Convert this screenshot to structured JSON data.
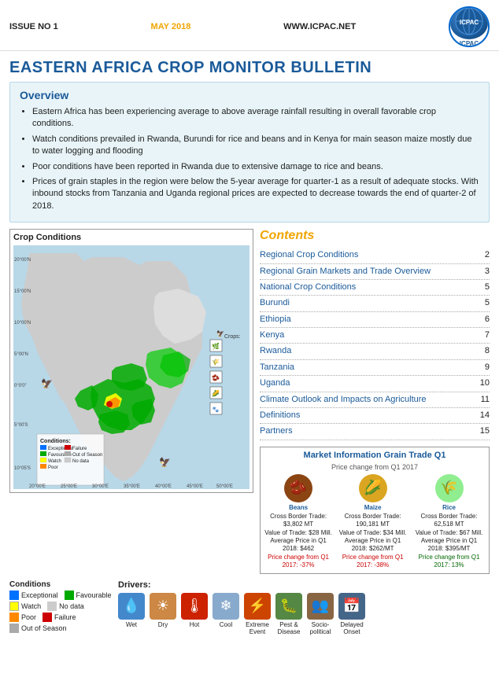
{
  "header": {
    "issue": "ISSUE NO 1",
    "date": "MAY 2018",
    "website": "WWW.ICPAC.NET",
    "logo_text": "ICPAC",
    "logo_sub": "ICPAC"
  },
  "main_title": "EASTERN AFRICA CROP MONITOR BULLETIN",
  "overview": {
    "title": "Overview",
    "bullets": [
      "Eastern Africa has been experiencing average to above average rainfall resulting in overall favorable crop conditions.",
      "Watch conditions prevailed in Rwanda, Burundi for rice and beans and in Kenya for main season maize mostly due to water logging and flooding",
      "Poor conditions have been reported in Rwanda due to extensive damage to rice and beans.",
      "Prices of grain staples in the region were below the 5-year average for quarter-1 as a result of adequate stocks. With inbound stocks from Tanzania and Uganda regional prices are expected to decrease towards the end of quarter-2 of 2018."
    ]
  },
  "crop_conditions": {
    "title": "Crop Conditions",
    "legend": {
      "title": "Conditions",
      "items": [
        {
          "label": "Exceptional",
          "color": "#0070ff"
        },
        {
          "label": "Favourable",
          "color": "#00aa00"
        },
        {
          "label": "Watch",
          "color": "#ffff00"
        },
        {
          "label": "No data",
          "color": "#cccccc"
        },
        {
          "label": "Poor",
          "color": "#ff8800"
        },
        {
          "label": "Failure",
          "color": "#cc0000"
        },
        {
          "label": "Out of Season",
          "color": "#aaaaaa"
        }
      ]
    },
    "map_x_labels": [
      "20°00'E",
      "25°00'E",
      "30°00'E",
      "35°00'E",
      "40°00'E",
      "45°00'E",
      "50°00'E"
    ],
    "map_y_labels": [
      "20°00'N",
      "15°00'N",
      "10°00'N",
      "5°00'N",
      "0°0'0\"",
      "5°00'S",
      "10°05'S"
    ]
  },
  "drivers": {
    "title": "Drivers:",
    "items": [
      {
        "label": "Wet",
        "icon": "💧",
        "color": "#4488cc"
      },
      {
        "label": "Dry",
        "icon": "☀",
        "color": "#cc8844"
      },
      {
        "label": "Hot",
        "icon": "🌡",
        "color": "#cc2200"
      },
      {
        "label": "Cool",
        "icon": "❄",
        "color": "#88aacc"
      }
    ],
    "extreme_items": [
      {
        "label": "Extreme\nEvent",
        "icon": "⚡",
        "color": "#cc4400"
      },
      {
        "label": "Pest &\nDisease",
        "icon": "🐛",
        "color": "#558844"
      },
      {
        "label": "Socio-\npolitical",
        "icon": "👥",
        "color": "#886644"
      },
      {
        "label": "Delayed\nOnset",
        "icon": "📅",
        "color": "#446688"
      }
    ]
  },
  "contents": {
    "title": "Contents",
    "items": [
      {
        "label": "Regional Crop Conditions",
        "dots": "......................",
        "page": "2"
      },
      {
        "label": "Regional Grain Markets and Trade Overview",
        "dots": "....................................................",
        "page": "3"
      },
      {
        "label": "National Crop Conditions",
        "dots": "....................",
        "page": "5"
      },
      {
        "label": "Burundi",
        "dots": "...................................................",
        "page": "5"
      },
      {
        "label": "Ethiopia",
        "dots": "..................................................",
        "page": "6"
      },
      {
        "label": "Kenya",
        "dots": ".....................................................",
        "page": "7"
      },
      {
        "label": "Rwanda",
        "dots": "...........................................",
        "page": "8"
      },
      {
        "label": "Tanzania",
        "dots": ".................................................",
        "page": "9"
      },
      {
        "label": "Uganda",
        "dots": ".................................................",
        "page": "10"
      },
      {
        "label": "Climate Outlook and Impacts on Agriculture",
        "dots": "....",
        "page": "11"
      },
      {
        "label": "Definitions",
        "dots": "...........................................",
        "page": "14"
      },
      {
        "label": "Partners",
        "dots": ".................................................",
        "page": "15"
      }
    ]
  },
  "market_info": {
    "title": "Market Information Grain Trade Q1",
    "subtitle": "Price change from Q1 2017",
    "commodities": [
      {
        "name": "Beans",
        "icon": "🫘",
        "color": "#8B4513",
        "data": [
          "Cross Border Trade: $3,802 MT",
          "Value of Trade: $28 Mill.",
          "Average Price in Q1 2018: $462",
          "Price change from Q1 2017: -37%"
        ],
        "trade_mt": "$3,802 MT",
        "trade_val": "$28 Mill.",
        "avg_price": "$462/MT",
        "pct_change": "-37%",
        "pct_dir": "down"
      },
      {
        "name": "Maize",
        "icon": "🌽",
        "color": "#DAA520",
        "data": [
          "Cross Border Trade: 190,181 MT",
          "Value of Trade: $34 Mill.",
          "Average Price in Q1 2018: $262/MT",
          "Price change from Q1 2017: -38%"
        ],
        "trade_mt": "190,181 MT",
        "trade_val": "$34 Mill.",
        "avg_price": "$262/MT",
        "pct_change": "-38%",
        "pct_dir": "down"
      },
      {
        "name": "Rice",
        "icon": "🌾",
        "color": "#90EE90",
        "data": [
          "Cross Border Trade: 62,518 MT",
          "Value of Trade: $67 Mill.",
          "Average Price in Q1 2018: $395/MT",
          "Price change from Q1 2017: 13%"
        ],
        "trade_mt": "62,518 MT",
        "trade_val": "$67 Mill.",
        "avg_price": "$395/MT",
        "pct_change": "13%",
        "pct_dir": "up"
      }
    ]
  }
}
